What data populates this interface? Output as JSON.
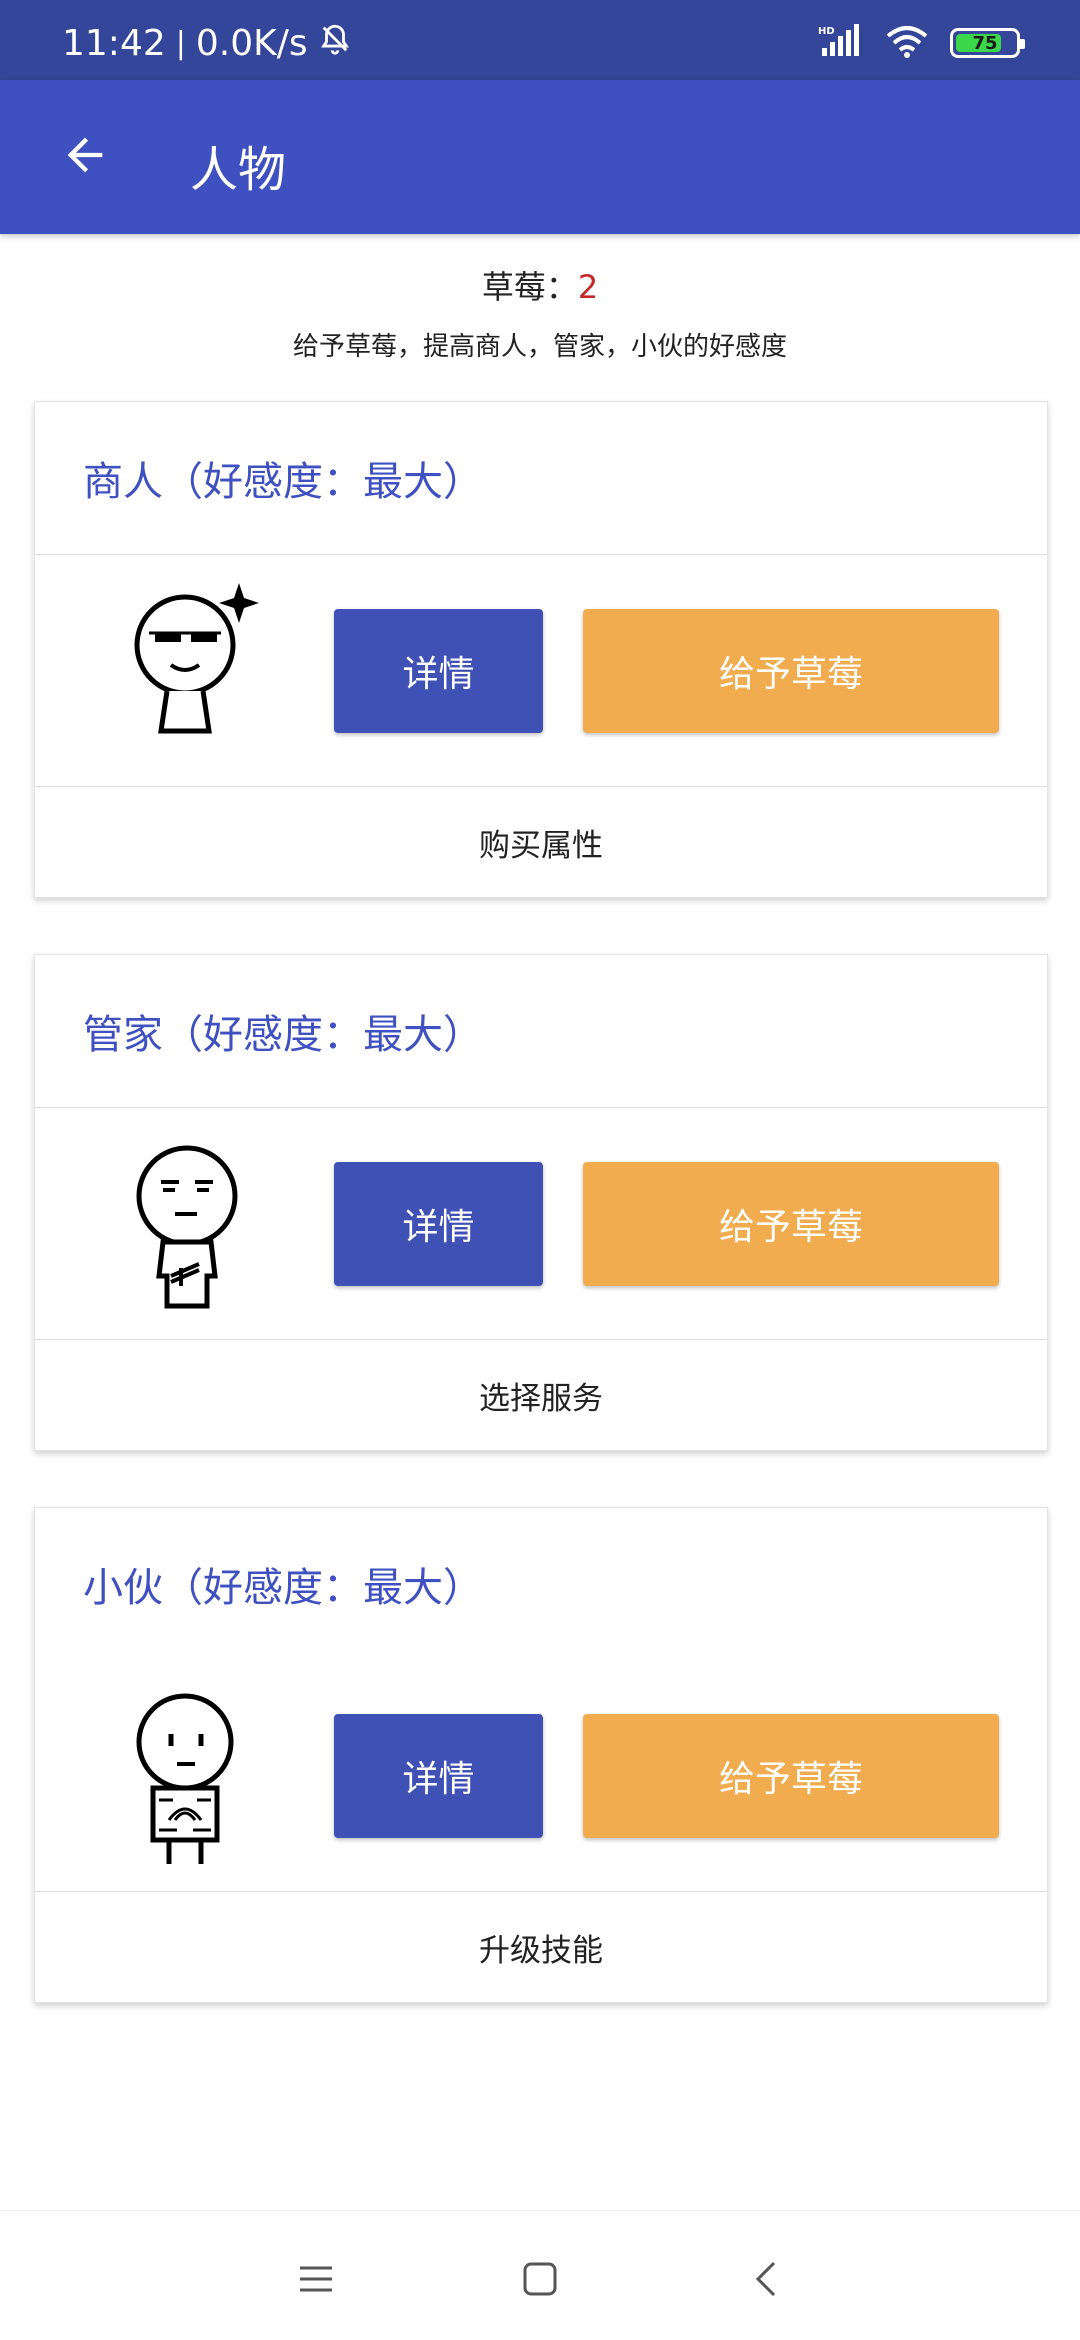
{
  "status_bar": {
    "time": "11:42",
    "separator": "|",
    "net_speed": "0.0K/s",
    "battery_level": "75",
    "icons": [
      "mute-bell-icon",
      "hd-signal-icon",
      "wifi-icon",
      "battery-icon"
    ]
  },
  "app_bar": {
    "title": "人物",
    "back_icon": "arrow-left-icon"
  },
  "summary": {
    "strawberry_label": "草莓：",
    "strawberry_count": "2",
    "hint": "给予草莓，提高商人，管家，小伙的好感度"
  },
  "characters": [
    {
      "title": "商人（好感度：最大）",
      "detail_label": "详情",
      "give_label": "给予草莓",
      "footer_action": "购买属性",
      "avatar_icon": "merchant-avatar-icon"
    },
    {
      "title": "管家（好感度：最大）",
      "detail_label": "详情",
      "give_label": "给予草莓",
      "footer_action": "选择服务",
      "avatar_icon": "butler-avatar-icon"
    },
    {
      "title": "小伙（好感度：最大）",
      "detail_label": "详情",
      "give_label": "给予草莓",
      "footer_action": "升级技能",
      "avatar_icon": "guy-avatar-icon"
    }
  ],
  "nav_bar": {
    "icons": [
      "menu-icon",
      "home-square-icon",
      "back-chevron-icon"
    ]
  },
  "colors": {
    "status_bar": "#33469a",
    "app_bar": "#3f51c0",
    "detail_button": "#3f51b5",
    "give_button": "#f0ac4f",
    "count_red": "#c62828"
  }
}
